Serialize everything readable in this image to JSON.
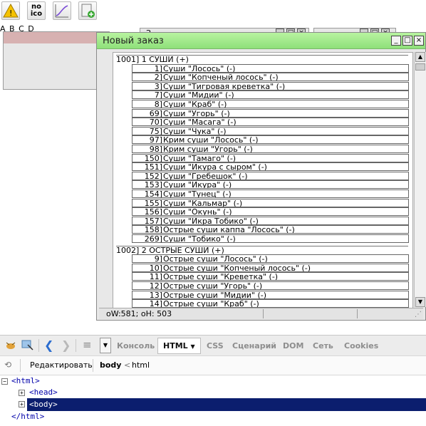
{
  "toolbar": {
    "noico_label": "no\nico",
    "abcd": "A B C D"
  },
  "bg_windows": {
    "partial_title": "З"
  },
  "dialog": {
    "title": "Новый заказ",
    "status": "oW:581; oH: 503",
    "groups": [
      {
        "header": "1001] 1 СУШИ (+)",
        "items": [
          {
            "num": "1]",
            "name": "Суши \"Лосось\" (-)"
          },
          {
            "num": "2]",
            "name": "Суши \"Копченый лосось\" (-)"
          },
          {
            "num": "3]",
            "name": "Суши \"Тигровая креветка\" (-)"
          },
          {
            "num": "7]",
            "name": "Суши \"Мидии\" (-)"
          },
          {
            "num": "8]",
            "name": "Суши \"Краб\" (-)"
          },
          {
            "num": "69]",
            "name": "Суши \"Угорь\" (-)"
          },
          {
            "num": "70]",
            "name": "Суши \"Масага\" (-)"
          },
          {
            "num": "75]",
            "name": "Суши \"Чука\" (-)"
          },
          {
            "num": "97]",
            "name": "Крим суши \"Лосось\" (-)"
          },
          {
            "num": "98]",
            "name": "Крим суши \"Угорь\" (-)"
          },
          {
            "num": "150]",
            "name": "Суши \"Тамаго\" (-)"
          },
          {
            "num": "151]",
            "name": "Суши \"Икура с сыром\" (-)"
          },
          {
            "num": "152]",
            "name": "Суши \"Гребешок\" (-)"
          },
          {
            "num": "153]",
            "name": "Суши \"Икура\" (-)"
          },
          {
            "num": "154]",
            "name": "Суши \"Тунец\" (-)"
          },
          {
            "num": "155]",
            "name": "Суши \"Кальмар\" (-)"
          },
          {
            "num": "156]",
            "name": "Суши \"Окунь\" (-)"
          },
          {
            "num": "157]",
            "name": "Суши \"Икра Тобико\" (-)"
          },
          {
            "num": "158]",
            "name": "Острые суши каппа \"Лосось\" (-)"
          },
          {
            "num": "269]",
            "name": "Суши \"Тобико\" (-)"
          }
        ]
      },
      {
        "header": "1002] 2 ОСТРЫЕ СУШИ (+)",
        "items": [
          {
            "num": "9]",
            "name": "Острые суши \"Лосось\" (-)"
          },
          {
            "num": "10]",
            "name": "Острые суши \"Копченый лосось\" (-)"
          },
          {
            "num": "11]",
            "name": "Острые суши \"Креветка\" (-)"
          },
          {
            "num": "12]",
            "name": "Острые суши \"Угорь\" (-)"
          },
          {
            "num": "13]",
            "name": "Острые суши \"Мидии\" (-)"
          },
          {
            "num": "14]",
            "name": "Острые суши \"Краб\" (-)"
          }
        ]
      }
    ]
  },
  "devtools": {
    "tabs": [
      "Консоль",
      "HTML",
      "CSS",
      "Сценарий",
      "DOM",
      "Сеть",
      "Cookies"
    ],
    "active_tab": "HTML",
    "edit_label": "Редактировать",
    "breadcrumb_current": "body",
    "breadcrumb_sep": "<",
    "breadcrumb_parent": "html",
    "tree": [
      "<html>",
      "<head>",
      "<body>",
      "</html>"
    ]
  },
  "colors": {
    "dialog_title": "#a6ea8e",
    "bg_window_title": "#d7b1b1",
    "devtools_selection": "#0b1e6e"
  }
}
